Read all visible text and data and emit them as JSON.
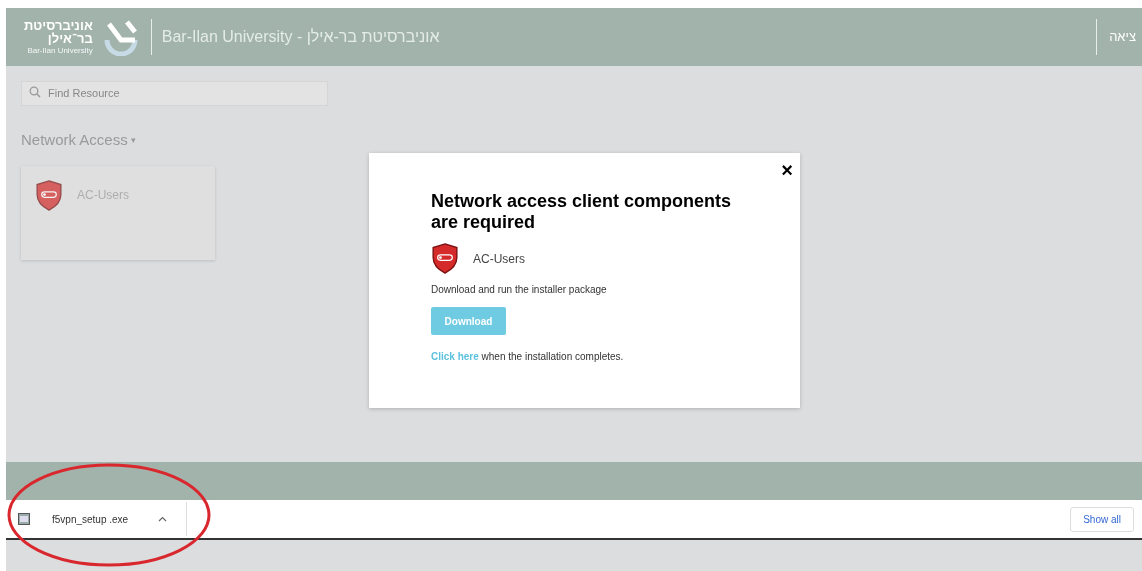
{
  "header": {
    "logo_hebrew_line1": "אוניברסיטת",
    "logo_hebrew_line2": "בר־אילן",
    "logo_english": "Bar-Ilan University",
    "title": "Bar-Ilan University - אוניברסיטת בר-אילן",
    "logout": "ציאה"
  },
  "search": {
    "placeholder": "Find Resource"
  },
  "section": {
    "title": "Network Access",
    "caret": "▾",
    "expanded": true
  },
  "resources": [
    {
      "name": "AC-Users"
    }
  ],
  "dialog": {
    "close": "×",
    "title": "Network access client components are required",
    "resource": "AC-Users",
    "instruction": "Download and run the installer package",
    "button": "Download",
    "link": "Click here",
    "link_rest": " when the installation completes."
  },
  "download_bar": {
    "items": [
      {
        "filename": "f5vpn_setup .exe"
      }
    ],
    "show_all": "Show all"
  },
  "annotation": {
    "kind": "ellipse",
    "color": "#d9272e"
  }
}
